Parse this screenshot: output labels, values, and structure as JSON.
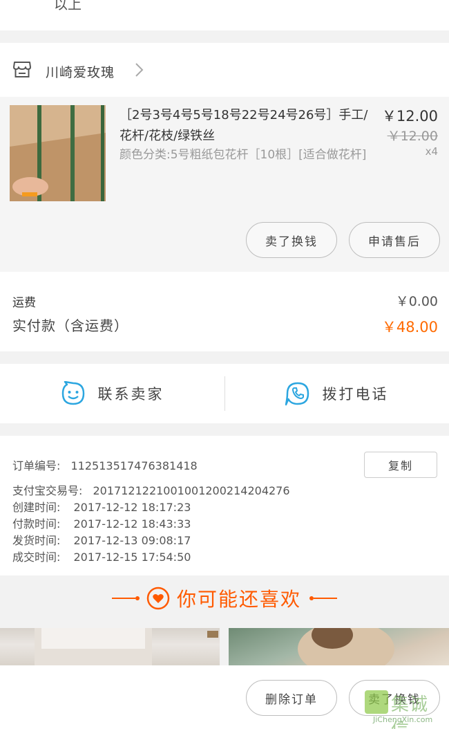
{
  "top": {
    "cut_text": "以上"
  },
  "shop": {
    "name": "川崎爱玫瑰"
  },
  "product": {
    "title": "［2号3号4号5号18号22号24号26号］手工/花杆/花枝/绿铁丝",
    "price": "￥12.00",
    "original_price": "￥12.00",
    "spec": "颜色分类:5号粗纸包花杆［10根］[适合做花杆]",
    "quantity": "x4",
    "btn_exchange": "卖了换钱",
    "btn_aftersale": "申请售后"
  },
  "fee": {
    "shipping_label": "运费",
    "shipping_value": "￥0.00",
    "paid_label": "实付款（含运费）",
    "paid_value": "￥48.00"
  },
  "contact": {
    "seller_label": "联系卖家",
    "call_label": "拨打电话"
  },
  "order_info": {
    "order_no_label": "订单编号:",
    "order_no": "112513517476381418",
    "copy_label": "复制",
    "alipay_label": "支付宝交易号:",
    "alipay_no": "2017121221001001200214204276",
    "created_label": "创建时间:",
    "created": "2017-12-12  18:17:23",
    "paid_label": "付款时间:",
    "paid": "2017-12-12  18:43:33",
    "shipped_label": "发货时间:",
    "shipped": "2017-12-13  09:08:17",
    "done_label": "成交时间:",
    "done": "2017-12-15  17:54:50"
  },
  "recommend": {
    "title": "你可能还喜欢"
  },
  "bottom": {
    "delete_label": "删除订单",
    "exchange_label": "卖了换钱"
  },
  "watermark": {
    "text": "集诚信",
    "url": "JiChengXin.com"
  },
  "colors": {
    "accent": "#ff6a00",
    "icon_blue": "#2ca6e0"
  }
}
